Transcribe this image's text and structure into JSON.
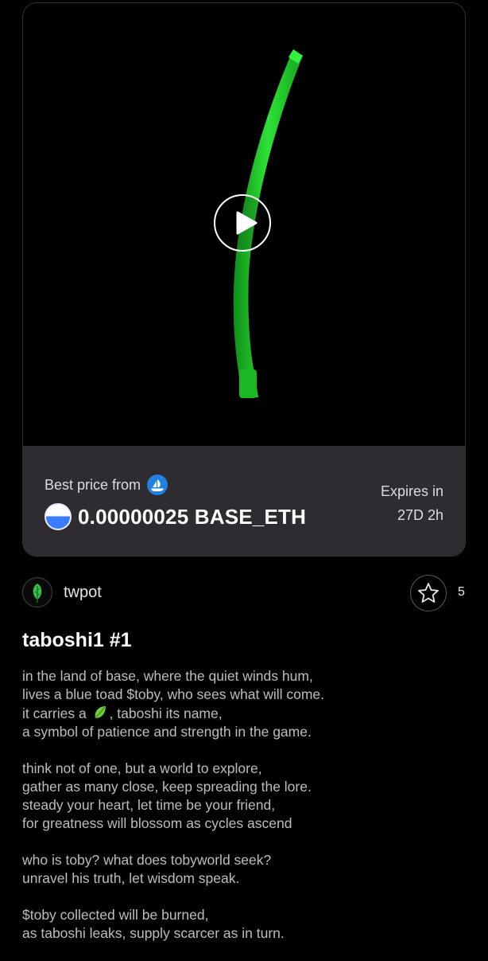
{
  "media": {
    "play_icon": "play-icon"
  },
  "price": {
    "best_label": "Best price from",
    "marketplace_icon": "opensea-icon",
    "currency_icon": "base-eth-icon",
    "value": "0.00000025 BASE_ETH",
    "expires_label": "Expires in",
    "expires_value": "27D 2h"
  },
  "creator": {
    "name": "twpot",
    "avatar_icon": "leaf-icon"
  },
  "favorite": {
    "icon": "star-icon",
    "count": "5"
  },
  "nft": {
    "title": "taboshi1 #1",
    "stanzas": [
      [
        "in the land of base, where the quiet winds hum,",
        "lives a blue toad $toby, who sees what will come.",
        "it carries a ",
        ", taboshi its name,",
        "a symbol of patience and strength in the game."
      ],
      [
        "think not of one, but a world to explore,",
        "gather as many close, keep spreading the lore.",
        "steady your heart, let time be your friend,",
        "for greatness will blossom as cycles ascend"
      ],
      [
        "who is toby? what does tobyworld seek?",
        "unravel his truth, let wisdom speak."
      ],
      [
        "$toby collected will be burned,",
        "as taboshi leaks, supply scarcer as in turn."
      ]
    ]
  },
  "colors": {
    "background": "#000000",
    "panel": "#2e2c30",
    "accent_green": "#22c42a",
    "opensea_blue": "#2081e2"
  }
}
